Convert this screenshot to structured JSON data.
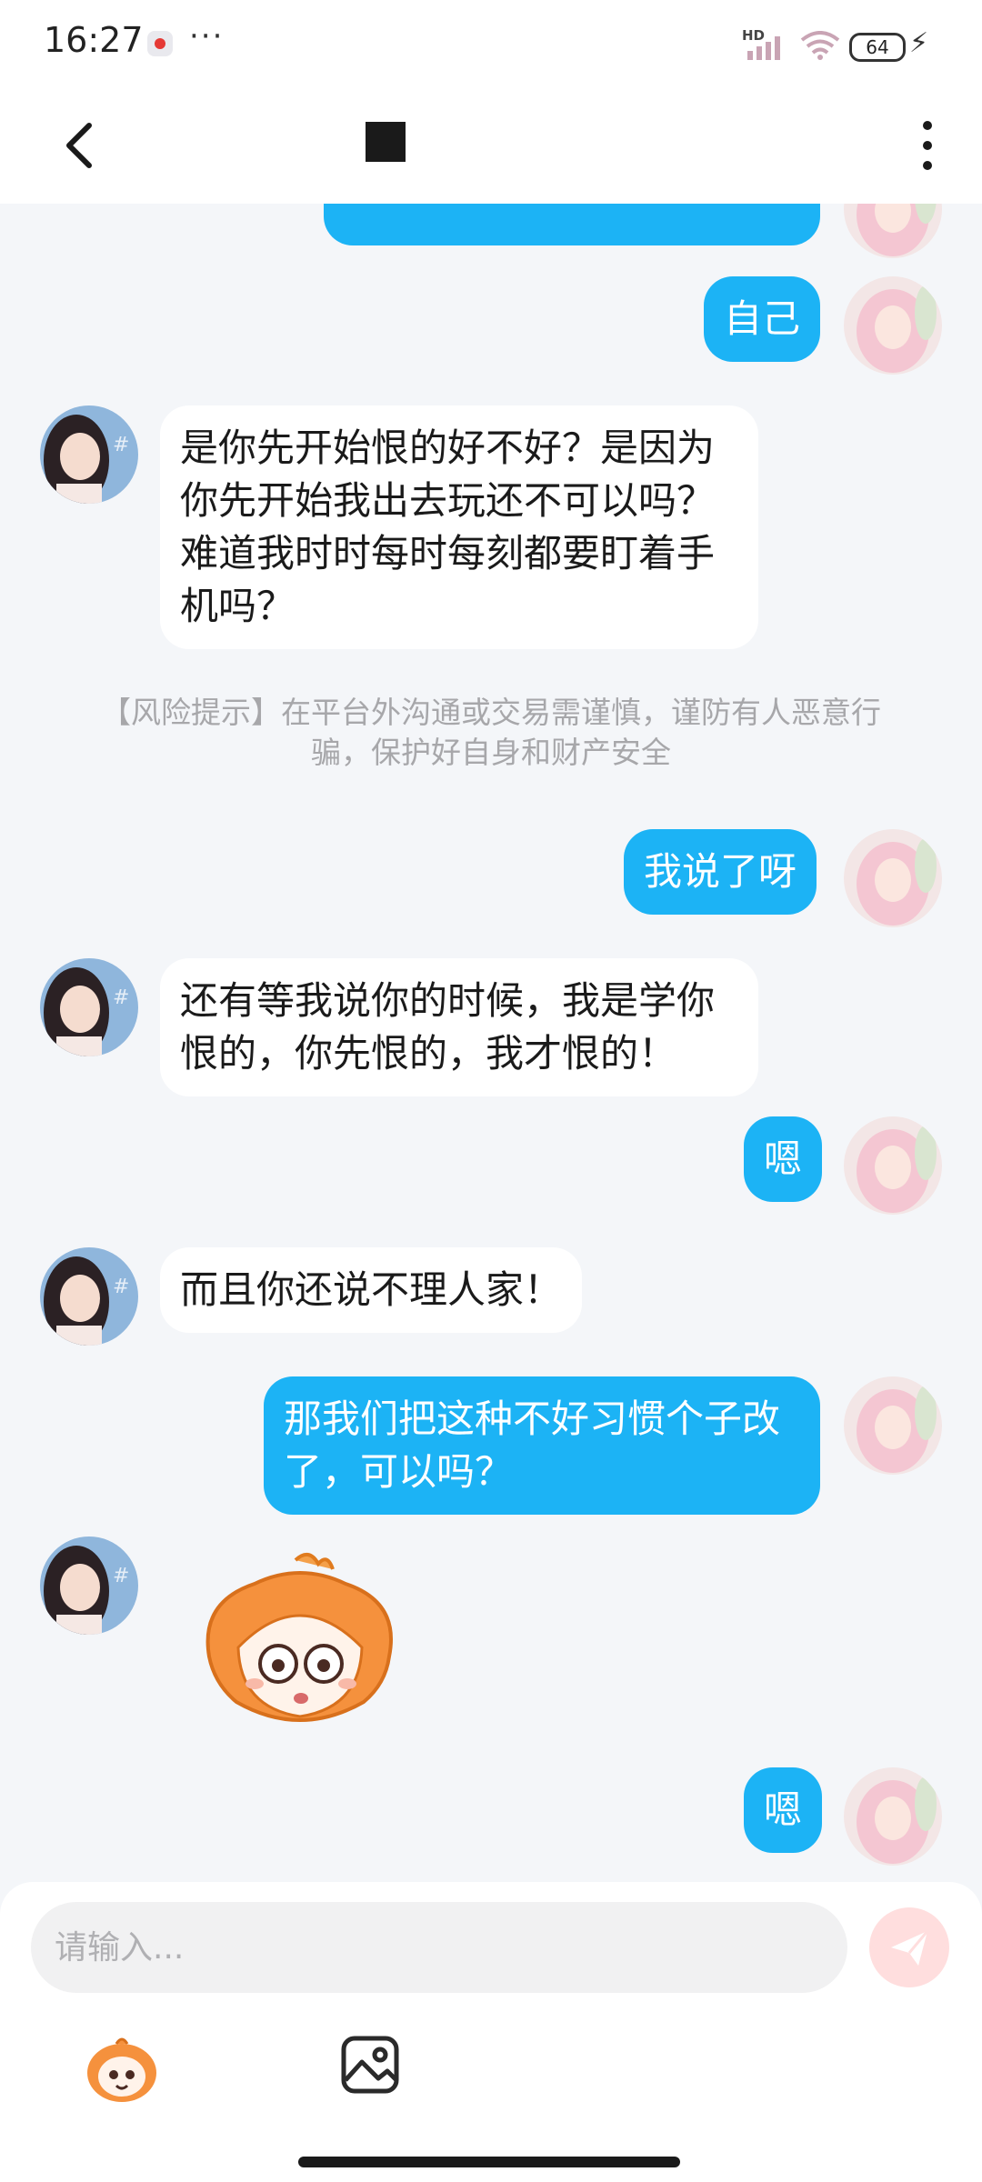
{
  "status_bar": {
    "time": "16:27",
    "dots": "···",
    "network": "HD",
    "battery": "64"
  },
  "header": {
    "back_icon": "chevron-left-icon",
    "more_icon": "more-vertical-icon"
  },
  "messages": [
    {
      "side": "out",
      "text": ""
    },
    {
      "side": "out",
      "text": "自己"
    },
    {
      "side": "in",
      "text": "是你先开始恨的好不好？是因为你先开始我出去玩还不可以吗？难道我时时每时每刻都要盯着手机吗？"
    },
    {
      "side": "out",
      "text": "我说了呀"
    },
    {
      "side": "in",
      "text": "还有等我说你的时候，我是学你恨的，你先恨的，我才恨的！"
    },
    {
      "side": "out",
      "text": "嗯"
    },
    {
      "side": "in",
      "text": "而且你还说不理人家！"
    },
    {
      "side": "out",
      "text": "那我们把这种不好习惯个子改了，可以吗？"
    },
    {
      "side": "in",
      "type": "sticker",
      "icon": "surprised-mascot-sticker"
    },
    {
      "side": "out",
      "text": "嗯"
    }
  ],
  "risk_notice": "【风险提示】在平台外沟通或交易需谨慎，谨防有人恶意行骗，保护好自身和财产安全",
  "input": {
    "placeholder": "请输入..."
  },
  "toolbar": {
    "emoji_icon": "mascot-emoji-icon",
    "image_icon": "image-icon",
    "send_icon": "send-icon"
  },
  "colors": {
    "outgoing_bubble": "#1cb3f5",
    "incoming_bubble": "#ffffff",
    "background": "#f4f6f9"
  }
}
